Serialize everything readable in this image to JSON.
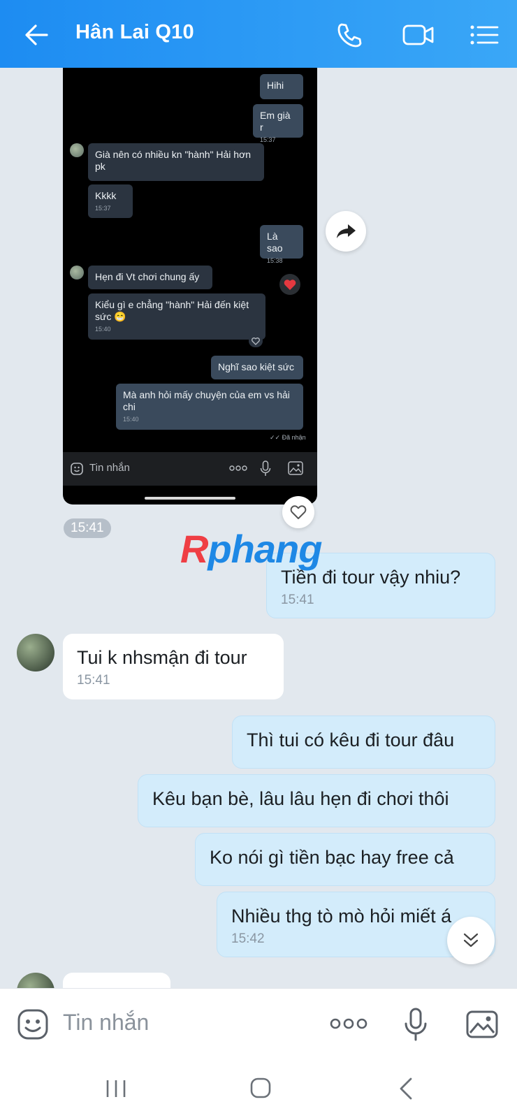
{
  "header": {
    "title": "Hân Lai Q10",
    "back_icon": "arrow-left-icon",
    "call_icon": "phone-icon",
    "video_icon": "video-camera-icon",
    "menu_icon": "list-menu-icon"
  },
  "embedded_screenshot": {
    "messages": [
      {
        "text": "Hihi",
        "side": "me"
      },
      {
        "text": "Em già r",
        "time": "15:37",
        "side": "me"
      },
      {
        "text": "Già nên có nhiều kn \"hành\" Hải hơn pk",
        "side": "them"
      },
      {
        "text": "Kkkk",
        "time": "15:37",
        "side": "them"
      },
      {
        "text": "Là sao",
        "time": "15:38",
        "side": "me"
      },
      {
        "text": "Hẹn đi Vt chơi chung ấy",
        "side": "them"
      },
      {
        "text": "Kiểu gì e chẳng \"hành\" Hải đến kiệt sức 😁",
        "time": "15:40",
        "side": "them"
      },
      {
        "text": "Nghĩ sao kiệt sức",
        "side": "me"
      },
      {
        "text": "Mà anh hỏi mấy chuyện của em vs hải chi",
        "time": "15:40",
        "side": "me"
      }
    ],
    "delivered_status": "✓✓ Đã nhận",
    "input_placeholder": "Tin nhắn"
  },
  "image_time": "15:41",
  "watermark": {
    "part1": "R",
    "part2": "phang"
  },
  "messages": [
    {
      "text": "Tiền đi tour vậy nhiu?",
      "time": "15:41",
      "side": "me"
    },
    {
      "text": "Tui k nhsmận đi tour",
      "time": "15:41",
      "side": "them"
    },
    {
      "text": "Thì tui có kêu đi tour đâu",
      "side": "me"
    },
    {
      "text": "Kêu bạn bè, lâu lâu hẹn đi chơi thôi",
      "side": "me"
    },
    {
      "text": "Ko nói gì tiền bạc hay free cả",
      "side": "me"
    },
    {
      "text": "Nhiều thg tò mò hỏi miết á",
      "time": "15:42",
      "side": "me"
    }
  ],
  "input": {
    "placeholder": "Tin nhắn",
    "more_label": "ooo"
  },
  "colors": {
    "header": "#2196f3",
    "my_bubble": "#d3ecfb",
    "their_bubble": "#ffffff",
    "background": "#e2e8ee"
  }
}
